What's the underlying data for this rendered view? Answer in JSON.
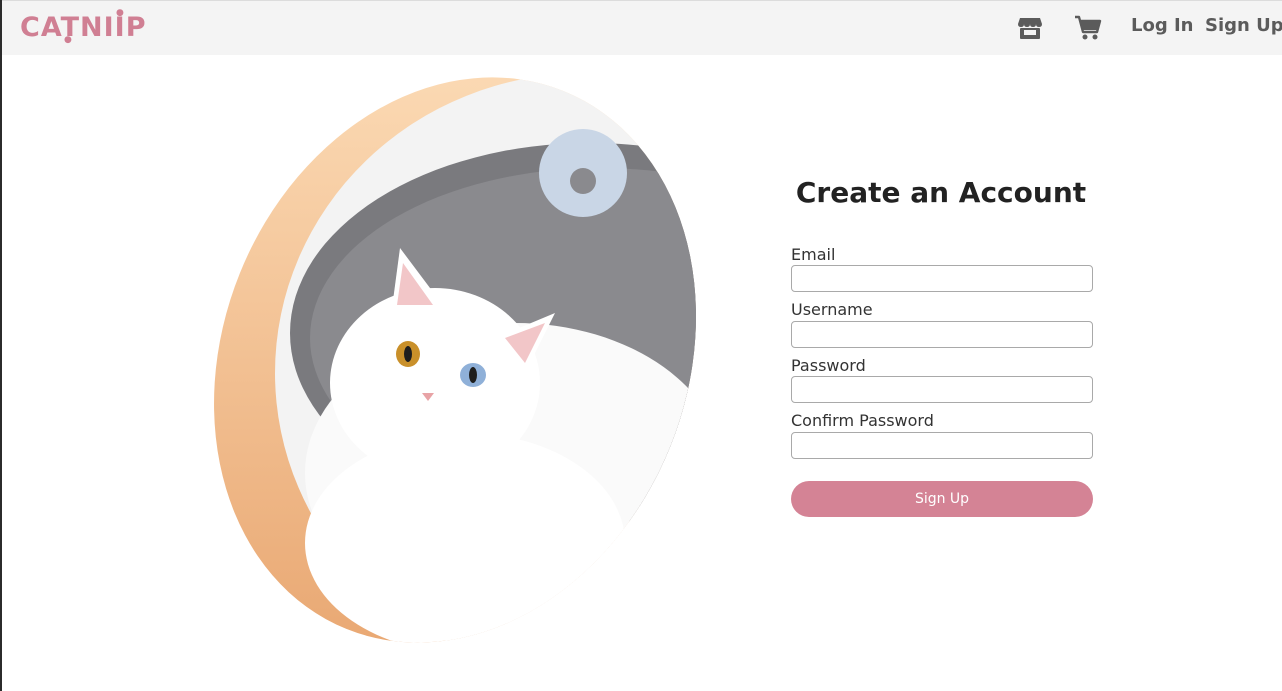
{
  "header": {
    "logo_text": "CATNIIP",
    "icons": {
      "store": "store-icon",
      "cart": "cart-icon"
    },
    "login_label": "Log In",
    "signup_label": "Sign Up"
  },
  "hero": {
    "image": "white-cat-in-felt-bed-illustration"
  },
  "form": {
    "title": "Create an Account",
    "fields": [
      {
        "label": "Email",
        "value": "",
        "placeholder": ""
      },
      {
        "label": "Username",
        "value": "",
        "placeholder": ""
      },
      {
        "label": "Password",
        "value": "",
        "placeholder": ""
      },
      {
        "label": "Confirm Password",
        "value": "",
        "placeholder": ""
      }
    ],
    "submit_label": "Sign Up"
  },
  "colors": {
    "brand": "#d07f93",
    "button": "#d48395",
    "header_bg": "#f4f4f4",
    "nav_text": "#5b5b5b",
    "hero_orange": "#f7c99a"
  }
}
